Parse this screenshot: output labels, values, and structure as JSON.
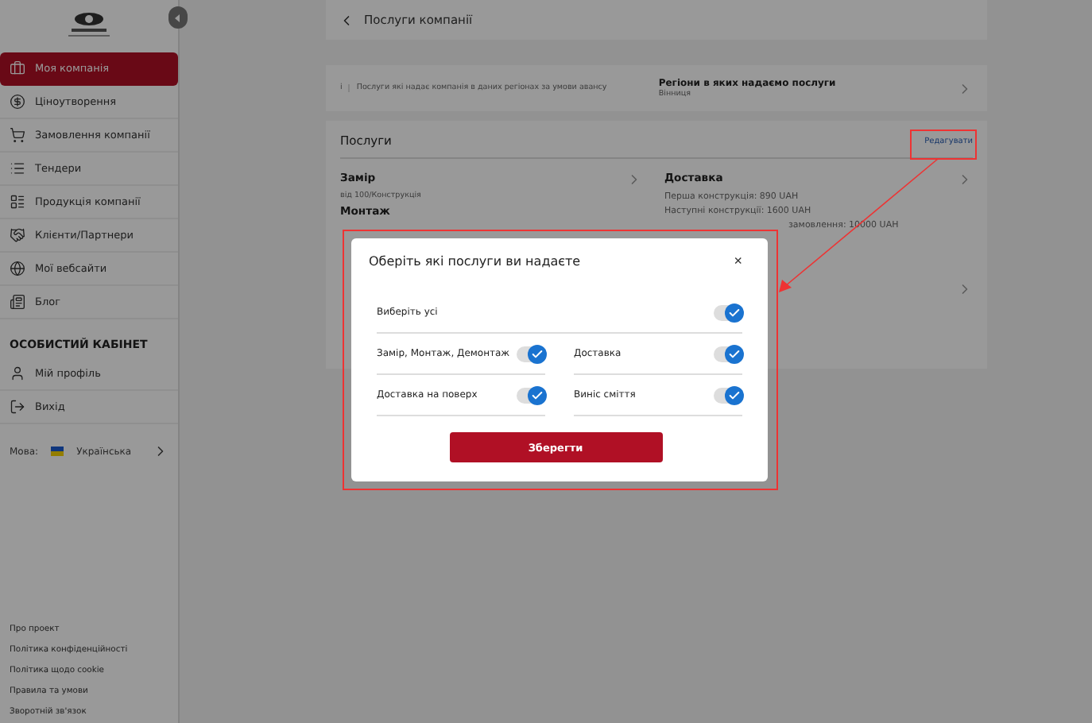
{
  "sidebar": {
    "items": [
      {
        "label": "Моя компанія",
        "selected": true
      },
      {
        "label": "Ціноутворення",
        "selected": false
      },
      {
        "label": "Замовлення компанії",
        "selected": false
      },
      {
        "label": "Тендери",
        "selected": false
      },
      {
        "label": "Продукція компанії",
        "selected": false
      },
      {
        "label": "Клієнти/Партнери",
        "selected": false
      },
      {
        "label": "Мої вебсайти",
        "selected": false
      },
      {
        "label": "Блог",
        "selected": false
      }
    ],
    "cabinet_title": "ОСОБИСТИЙ КАБІНЕТ",
    "cabinet_items": [
      {
        "label": "Мій профіль"
      },
      {
        "label": "Вихід"
      }
    ],
    "language": {
      "label": "Мова:",
      "value": "Українська"
    },
    "footer_links": [
      "Про проект",
      "Політика конфіденційності",
      "Політика щодо cookie",
      "Правила та умови",
      "Зворотній зв'язок"
    ]
  },
  "header": {
    "title": "Послуги компанії"
  },
  "info": {
    "icon": "i",
    "text": "Послуги які надає компанія в даних регіонах за умови авансу",
    "regions_title": "Регіони в яких надаємо послуги",
    "regions_value": "Вінниця"
  },
  "services": {
    "title": "Послуги",
    "edit_link": "Редагувати",
    "left": [
      {
        "name": "Замір",
        "detail": "від 100/Конструкція"
      },
      {
        "name": "Монтаж"
      }
    ],
    "right": {
      "name": "Доставка",
      "lines": [
        "Перша конструкція: 890 UAH",
        "Наступні конструкції: 1600 UAH"
      ],
      "partial_line": "замовлення: 10000 UAH"
    }
  },
  "modal": {
    "title": "Оберіть які послуги ви надаєте",
    "close": "×",
    "select_all": {
      "label": "Виберіть усі",
      "checked": true
    },
    "options": [
      {
        "label": "Замір, Монтаж, Демонтаж",
        "checked": true
      },
      {
        "label": "Доставка",
        "checked": true
      },
      {
        "label": "Доставка на поверх",
        "checked": true
      },
      {
        "label": "Виніс сміття",
        "checked": true
      }
    ],
    "save": "Зберегти"
  }
}
